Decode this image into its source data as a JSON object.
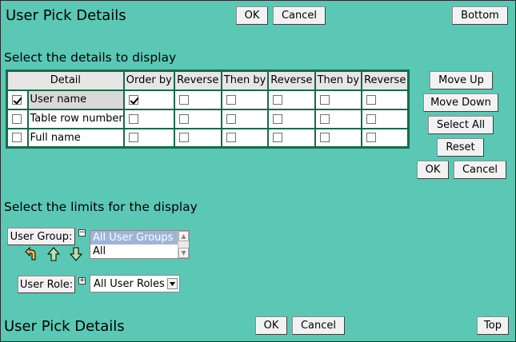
{
  "header": {
    "title": "User Pick Details",
    "ok_label": "OK",
    "cancel_label": "Cancel",
    "bottom_label": "Bottom"
  },
  "details_section": {
    "title": "Select the details to display",
    "columns": [
      "Detail",
      "Order by",
      "Reverse",
      "Then by",
      "Reverse",
      "Then by",
      "Reverse"
    ],
    "rows": [
      {
        "label": "User name",
        "selected": true,
        "order_by": true
      },
      {
        "label": "Table row number",
        "selected": false,
        "order_by": false
      },
      {
        "label": "Full name",
        "selected": false,
        "order_by": false
      }
    ],
    "buttons": {
      "move_up": "Move Up",
      "move_down": "Move Down",
      "select_all": "Select All",
      "reset": "Reset",
      "ok": "OK",
      "cancel": "Cancel"
    }
  },
  "limits_section": {
    "title": "Select the limits for the display",
    "user_group_label": "User Group:",
    "user_group_options": [
      "All User Groups",
      "All"
    ],
    "user_group_selected": "All User Groups",
    "user_role_label": "User Role:",
    "user_role_value": "All User Roles",
    "toggle_collapse": "−",
    "toggle_expand": "+"
  },
  "footer": {
    "title": "User Pick Details",
    "ok_label": "OK",
    "cancel_label": "Cancel",
    "top_label": "Top"
  },
  "colors": {
    "background": "#5ac8b5",
    "table_border": "#176b4a",
    "listbox_selected": "#9fb4d9"
  }
}
